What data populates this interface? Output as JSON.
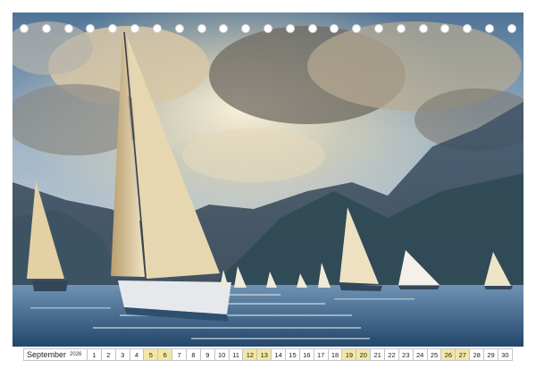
{
  "calendar": {
    "month": "September",
    "year": "2026",
    "days": [
      {
        "n": "1",
        "weekend": false
      },
      {
        "n": "2",
        "weekend": false
      },
      {
        "n": "3",
        "weekend": false
      },
      {
        "n": "4",
        "weekend": false
      },
      {
        "n": "5",
        "weekend": true
      },
      {
        "n": "6",
        "weekend": true
      },
      {
        "n": "7",
        "weekend": false
      },
      {
        "n": "8",
        "weekend": false
      },
      {
        "n": "9",
        "weekend": false
      },
      {
        "n": "10",
        "weekend": false
      },
      {
        "n": "11",
        "weekend": false
      },
      {
        "n": "12",
        "weekend": true
      },
      {
        "n": "13",
        "weekend": true
      },
      {
        "n": "14",
        "weekend": false
      },
      {
        "n": "15",
        "weekend": false
      },
      {
        "n": "16",
        "weekend": false
      },
      {
        "n": "17",
        "weekend": false
      },
      {
        "n": "18",
        "weekend": false
      },
      {
        "n": "19",
        "weekend": true
      },
      {
        "n": "20",
        "weekend": true
      },
      {
        "n": "21",
        "weekend": false
      },
      {
        "n": "22",
        "weekend": false
      },
      {
        "n": "23",
        "weekend": false
      },
      {
        "n": "24",
        "weekend": false
      },
      {
        "n": "25",
        "weekend": false
      },
      {
        "n": "26",
        "weekend": true
      },
      {
        "n": "27",
        "weekend": true
      },
      {
        "n": "28",
        "weekend": false
      },
      {
        "n": "29",
        "weekend": false
      },
      {
        "n": "30",
        "weekend": false
      }
    ]
  },
  "colors": {
    "weekend": "#f4e7a3",
    "sky": "#6f8fae",
    "water": "#3f6a92",
    "sail": "#e6d5ae"
  },
  "photo": {
    "subject": "sailing-regatta-photo"
  }
}
